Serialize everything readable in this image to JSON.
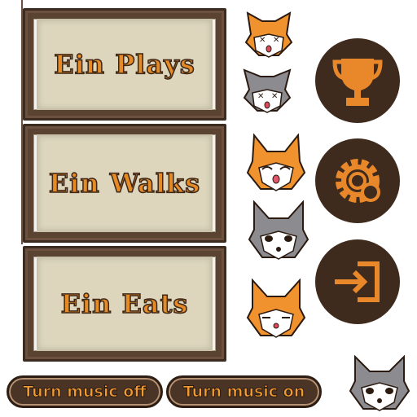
{
  "menu": {
    "plays_label": "Ein Plays",
    "walks_label": "Ein Walks",
    "eats_label": "Ein Eats"
  },
  "actions": {
    "trophy_icon": "trophy-icon",
    "settings_icon": "gear-icon",
    "exit_icon": "exit-icon"
  },
  "music": {
    "off_label": "Turn music off",
    "on_label": "Turn music on"
  },
  "colors": {
    "frame": "#5b4332",
    "panel": "#ddd6bd",
    "accent": "#e58a25",
    "button": "#3f2b1e"
  }
}
